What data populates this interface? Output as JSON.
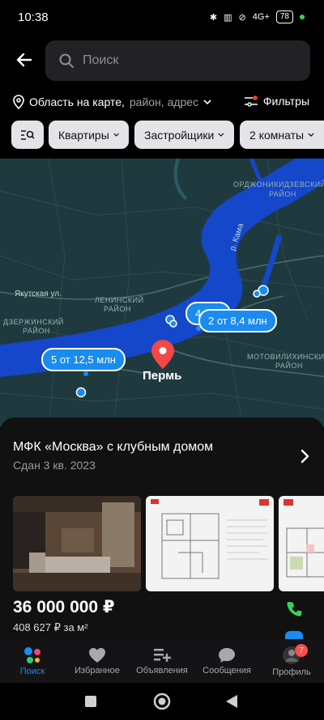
{
  "status_bar": {
    "time": "10:38",
    "network": "4G+",
    "battery": "78"
  },
  "header": {
    "back_icon": "arrow-left-icon",
    "search_placeholder": "Поиск"
  },
  "location": {
    "primary": "Область на карте,",
    "secondary": "район, адрес",
    "filters_label": "Фильтры"
  },
  "chips": [
    {
      "label": "Квартиры"
    },
    {
      "label": "Застройщики"
    },
    {
      "label": "2 комнаты"
    }
  ],
  "map": {
    "labels": {
      "ordzh": "ОРДЖОНИКИДЗЕВСКИЙ",
      "ordzh2": "РАЙОН",
      "kama": "р. Кама",
      "yakut": "Якутская ул.",
      "lenin": "ЛЕНИНСКИЙ",
      "lenin2": "РАЙОН",
      "dzer": "ДЗЕРЖИНСКИЙ",
      "dzer2": "РАЙОН",
      "motov": "МОТОВИЛИХИНСКИЙ",
      "motov2": "РАЙОН",
      "city": "Пермь"
    },
    "bubbles": [
      {
        "label": "2 от 8,4 млн"
      },
      {
        "label": "5 от 12,5 млн"
      },
      {
        "label": "4 от"
      }
    ]
  },
  "card": {
    "title": "МФК «Москва» с клубным домом",
    "subtitle": "Сдан 3 кв. 2023",
    "price": "36 000 000 ₽",
    "price_per_m": "408 627 ₽ за м²"
  },
  "bottom_nav": [
    {
      "label": "Поиск",
      "icon": "search-dots-icon"
    },
    {
      "label": "Избранное",
      "icon": "heart-icon"
    },
    {
      "label": "Объявления",
      "icon": "add-list-icon"
    },
    {
      "label": "Сообщения",
      "icon": "chat-icon"
    },
    {
      "label": "Профиль",
      "icon": "avatar-icon",
      "badge": "7"
    }
  ],
  "colors": {
    "accent": "#1a8cf0",
    "map_bg": "#1f3a3f",
    "river": "#1447c9",
    "call": "#3ad15c"
  }
}
